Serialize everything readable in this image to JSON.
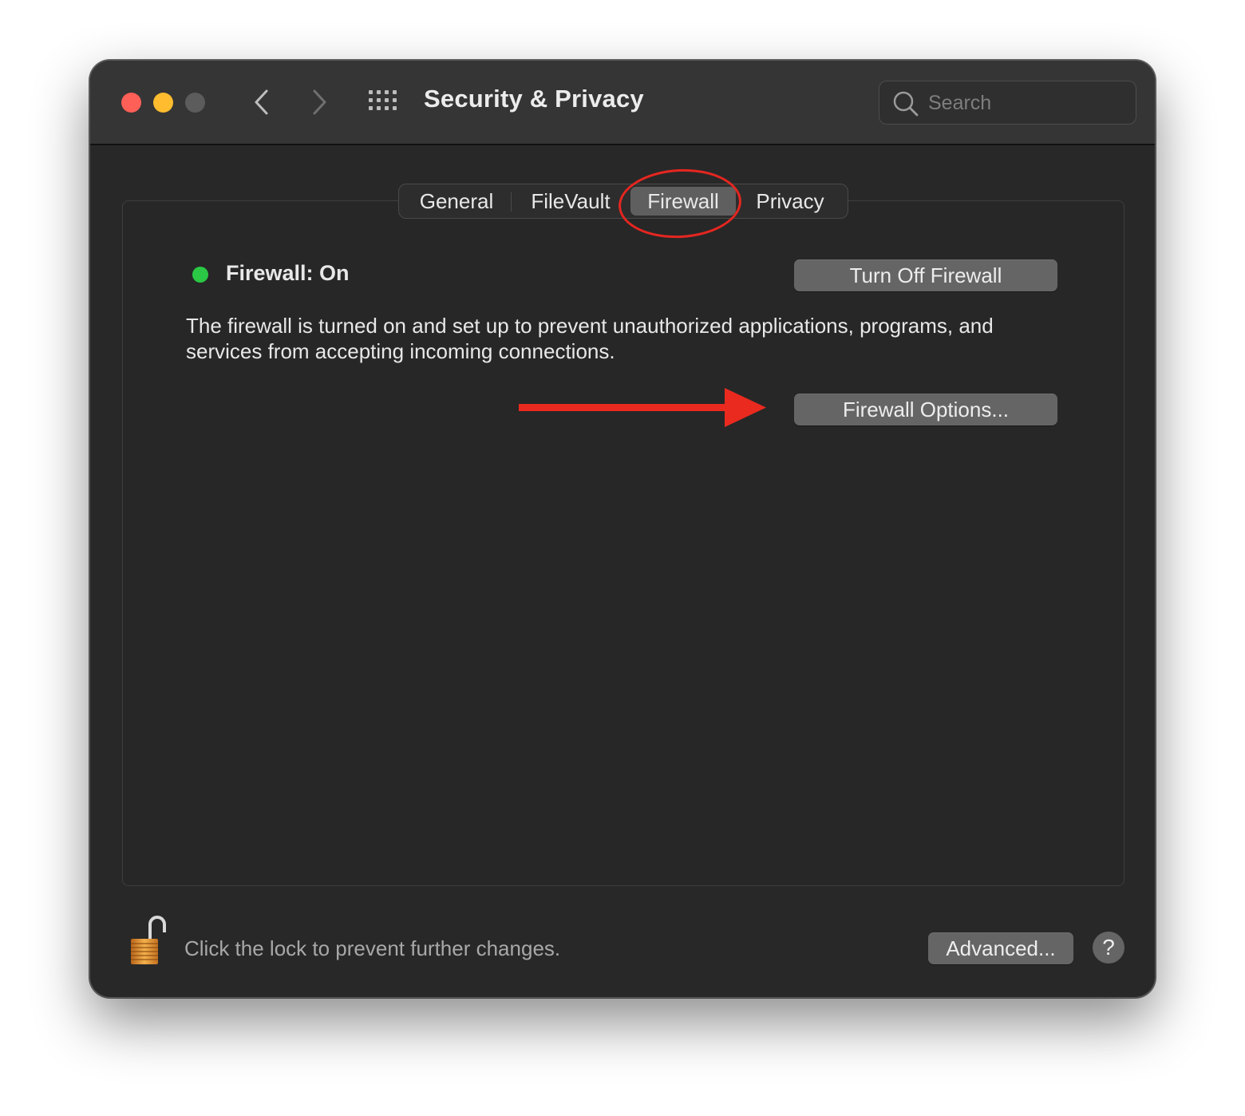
{
  "window": {
    "title": "Security & Privacy",
    "controls": [
      "close",
      "minimize",
      "zoom"
    ]
  },
  "toolbar": {
    "back_icon": "chevron-left-icon",
    "forward_icon": "chevron-right-icon",
    "show_all_icon": "grid-icon",
    "search": {
      "placeholder": "Search",
      "icon": "search-icon"
    }
  },
  "tabs": [
    {
      "label": "General",
      "selected": false
    },
    {
      "label": "FileVault",
      "selected": false
    },
    {
      "label": "Firewall",
      "selected": true
    },
    {
      "label": "Privacy",
      "selected": false
    }
  ],
  "firewall": {
    "status_label": "Firewall: On",
    "status_color": "#2ac845",
    "turn_off_label": "Turn Off Firewall",
    "description": "The firewall is turned on and set up to prevent unauthorized applications, programs, and services from accepting incoming connections.",
    "options_label": "Firewall Options..."
  },
  "footer": {
    "lock_icon": "unlocked-padlock-icon",
    "lock_text": "Click the lock to prevent further changes.",
    "advanced_label": "Advanced...",
    "help_label": "?"
  },
  "annotations": {
    "highlight_color": "#e52620",
    "circle_target": "Firewall tab",
    "arrow_target": "Firewall Options... button"
  }
}
